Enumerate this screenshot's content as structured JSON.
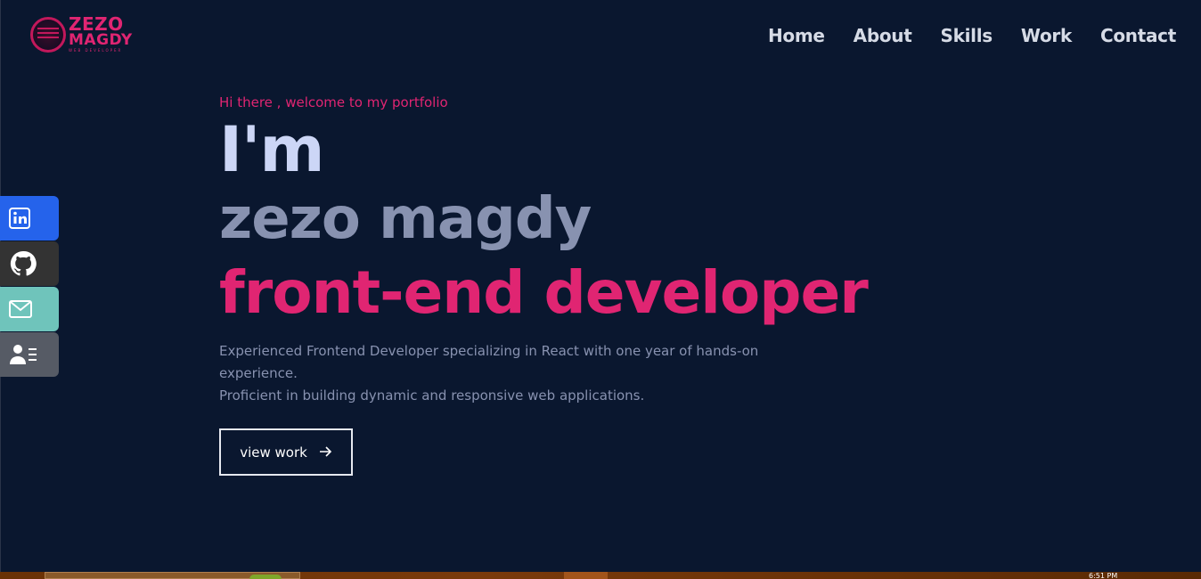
{
  "header": {
    "logo": {
      "line1": "ZEZO",
      "line2": "MAGDY",
      "sub": "WEB DEVELOPER"
    },
    "nav": [
      {
        "label": "Home"
      },
      {
        "label": "About"
      },
      {
        "label": "Skills"
      },
      {
        "label": "Work"
      },
      {
        "label": "Contact"
      }
    ]
  },
  "social": [
    {
      "name": "linkedin",
      "icon": "linkedin-icon",
      "color": "#2563eb"
    },
    {
      "name": "github",
      "icon": "github-icon",
      "color": "#333333"
    },
    {
      "name": "email",
      "icon": "mail-icon",
      "color": "#6fc4bb"
    },
    {
      "name": "resume",
      "icon": "contact-card-icon",
      "color": "#565b65"
    }
  ],
  "hero": {
    "greeting": "Hi there , welcome to my portfolio",
    "intro": "I'm",
    "name": "zezo magdy",
    "role": "front-end developer",
    "description_line1": "Experienced Frontend Developer specializing in React with one year of hands-on experience.",
    "description_line2": "Proficient in building dynamic and responsive web applications.",
    "button_label": "view work",
    "button_icon": "arrow-right-icon"
  },
  "taskbar": {
    "clock": "6:51 PM"
  },
  "colors": {
    "background": "#0a172f",
    "accent": "#e02572",
    "heading": "#ccd6f6",
    "muted": "#8892b0"
  }
}
